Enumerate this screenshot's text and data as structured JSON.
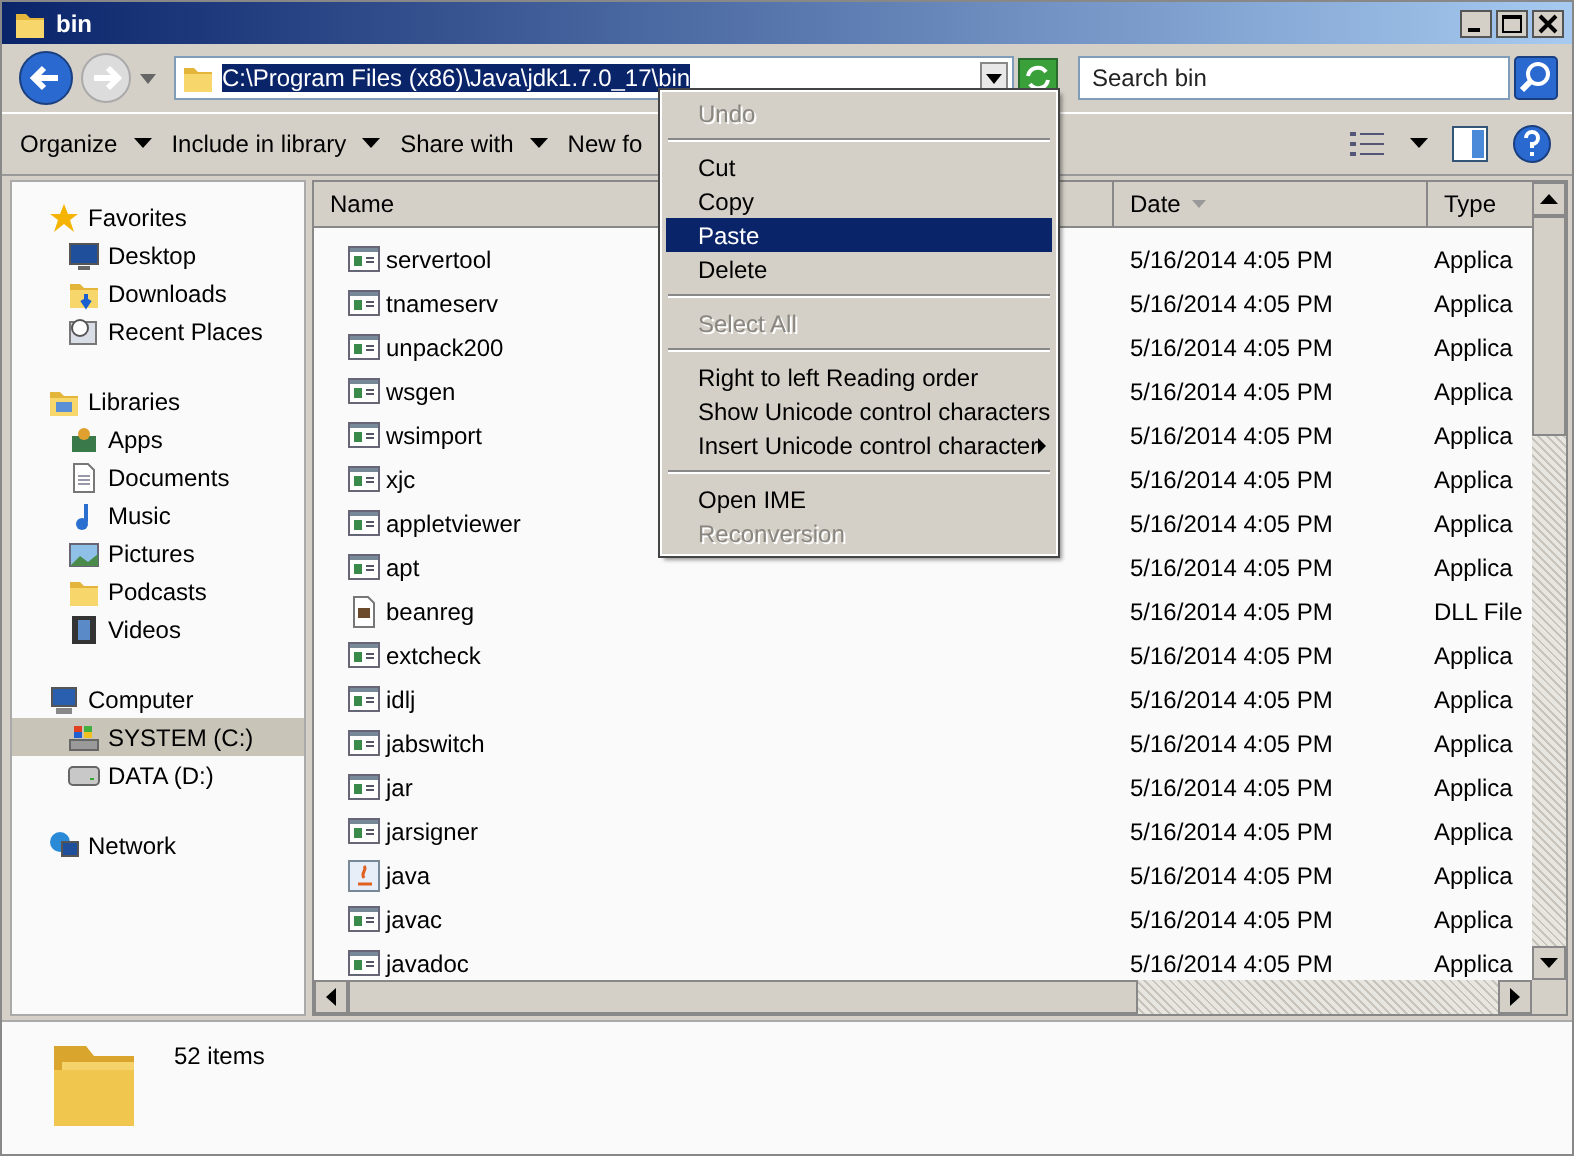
{
  "window": {
    "title": "bin"
  },
  "address": {
    "value": "C:\\Program Files (x86)\\Java\\jdk1.7.0_17\\bin",
    "selected": true
  },
  "search": {
    "placeholder": "Search bin"
  },
  "toolbar": [
    {
      "label": "Organize"
    },
    {
      "label": "Include in library"
    },
    {
      "label": "Share with"
    },
    {
      "label": "New fo"
    }
  ],
  "sidebar": [
    {
      "label": "Favorites",
      "kind": "star",
      "selected": false,
      "children": [
        {
          "label": "Desktop",
          "kind": "desktop",
          "selected": false
        },
        {
          "label": "Downloads",
          "kind": "downloads",
          "selected": false
        },
        {
          "label": "Recent Places",
          "kind": "recent",
          "selected": false
        }
      ]
    },
    {
      "label": "Libraries",
      "kind": "library",
      "selected": false,
      "children": [
        {
          "label": "Apps",
          "kind": "apps",
          "selected": false
        },
        {
          "label": "Documents",
          "kind": "documents",
          "selected": false
        },
        {
          "label": "Music",
          "kind": "music",
          "selected": false
        },
        {
          "label": "Pictures",
          "kind": "pictures",
          "selected": false
        },
        {
          "label": "Podcasts",
          "kind": "folder",
          "selected": false
        },
        {
          "label": "Videos",
          "kind": "videos",
          "selected": false
        }
      ]
    },
    {
      "label": "Computer",
      "kind": "computer",
      "selected": false,
      "children": [
        {
          "label": "SYSTEM (C:)",
          "kind": "system-drive",
          "selected": true
        },
        {
          "label": "DATA (D:)",
          "kind": "drive",
          "selected": false
        }
      ]
    },
    {
      "label": "Network",
      "kind": "network",
      "selected": false
    }
  ],
  "table": {
    "columns": [
      {
        "label": "Name",
        "sorted": false
      },
      {
        "label": "Date",
        "sorted": true
      },
      {
        "label": "Type",
        "sorted": false
      }
    ],
    "rows": [
      {
        "name": "servertool",
        "kind": "exe",
        "date": "5/16/2014 4:05 PM",
        "type": "Applica"
      },
      {
        "name": "tnameserv",
        "kind": "exe",
        "date": "5/16/2014 4:05 PM",
        "type": "Applica"
      },
      {
        "name": "unpack200",
        "kind": "exe",
        "date": "5/16/2014 4:05 PM",
        "type": "Applica"
      },
      {
        "name": "wsgen",
        "kind": "exe",
        "date": "5/16/2014 4:05 PM",
        "type": "Applica"
      },
      {
        "name": "wsimport",
        "kind": "exe",
        "date": "5/16/2014 4:05 PM",
        "type": "Applica"
      },
      {
        "name": "xjc",
        "kind": "exe",
        "date": "5/16/2014 4:05 PM",
        "type": "Applica"
      },
      {
        "name": "appletviewer",
        "kind": "exe",
        "date": "5/16/2014 4:05 PM",
        "type": "Applica"
      },
      {
        "name": "apt",
        "kind": "exe",
        "date": "5/16/2014 4:05 PM",
        "type": "Applica"
      },
      {
        "name": "beanreg",
        "kind": "dll",
        "date": "5/16/2014 4:05 PM",
        "type": "DLL File"
      },
      {
        "name": "extcheck",
        "kind": "exe",
        "date": "5/16/2014 4:05 PM",
        "type": "Applica"
      },
      {
        "name": "idlj",
        "kind": "exe",
        "date": "5/16/2014 4:05 PM",
        "type": "Applica"
      },
      {
        "name": "jabswitch",
        "kind": "exe",
        "date": "5/16/2014 4:05 PM",
        "type": "Applica"
      },
      {
        "name": "jar",
        "kind": "exe",
        "date": "5/16/2014 4:05 PM",
        "type": "Applica"
      },
      {
        "name": "jarsigner",
        "kind": "exe",
        "date": "5/16/2014 4:05 PM",
        "type": "Applica"
      },
      {
        "name": "java",
        "kind": "java",
        "date": "5/16/2014 4:05 PM",
        "type": "Applica"
      },
      {
        "name": "javac",
        "kind": "exe",
        "date": "5/16/2014 4:05 PM",
        "type": "Applica"
      },
      {
        "name": "javadoc",
        "kind": "exe",
        "date": "5/16/2014 4:05 PM",
        "type": "Applica"
      }
    ]
  },
  "context_menu": [
    {
      "kind": "item",
      "label": "Undo",
      "disabled": true,
      "selected": false,
      "submenu": false
    },
    {
      "kind": "separator"
    },
    {
      "kind": "item",
      "label": "Cut",
      "disabled": false,
      "selected": false,
      "submenu": false
    },
    {
      "kind": "item",
      "label": "Copy",
      "disabled": false,
      "selected": false,
      "submenu": false
    },
    {
      "kind": "item",
      "label": "Paste",
      "disabled": false,
      "selected": true,
      "submenu": false
    },
    {
      "kind": "item",
      "label": "Delete",
      "disabled": false,
      "selected": false,
      "submenu": false
    },
    {
      "kind": "separator"
    },
    {
      "kind": "item",
      "label": "Select All",
      "disabled": true,
      "selected": false,
      "submenu": false
    },
    {
      "kind": "separator"
    },
    {
      "kind": "item",
      "label": "Right to left Reading order",
      "disabled": false,
      "selected": false,
      "submenu": false
    },
    {
      "kind": "item",
      "label": "Show Unicode control characters",
      "disabled": false,
      "selected": false,
      "submenu": false
    },
    {
      "kind": "item",
      "label": "Insert Unicode control character",
      "disabled": false,
      "selected": false,
      "submenu": true
    },
    {
      "kind": "separator"
    },
    {
      "kind": "item",
      "label": "Open IME",
      "disabled": false,
      "selected": false,
      "submenu": false
    },
    {
      "kind": "item",
      "label": "Reconversion",
      "disabled": true,
      "selected": false,
      "submenu": false
    }
  ],
  "status_bar": {
    "count": "52 items"
  }
}
